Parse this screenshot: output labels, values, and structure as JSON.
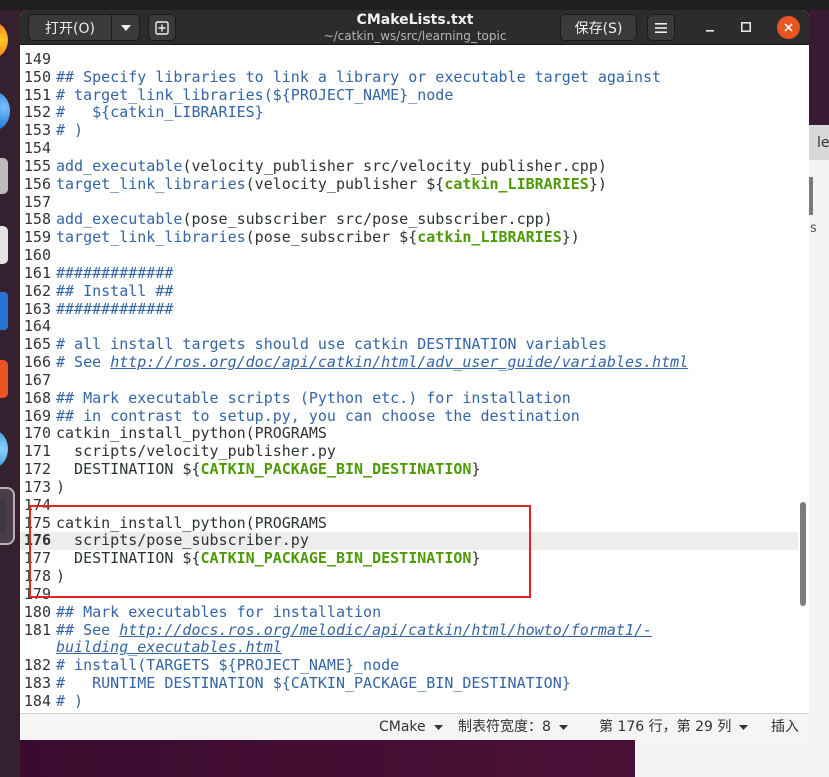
{
  "window": {
    "title": "CMakeLists.txt",
    "subtitle": "~/catkin_ws/src/learning_topic"
  },
  "header": {
    "open_label": "打开(O)",
    "open_menu_icon": "chevron-down-icon",
    "new_tab_icon": "tab-new-icon",
    "save_label": "保存(S)",
    "menu_icon": "hamburger-menu-icon",
    "window_controls": {
      "minimize_icon": "minimize-icon",
      "maximize_icon": "maximize-icon",
      "close_icon": "close-icon"
    }
  },
  "editor": {
    "lines": [
      {
        "n": "149",
        "seg": []
      },
      {
        "n": "150",
        "seg": [
          {
            "t": "## Specify libraries to link a library or executable target against",
            "c": "#3465a4"
          }
        ]
      },
      {
        "n": "151",
        "seg": [
          {
            "t": "# target_link_libraries(${PROJECT_NAME}_node",
            "c": "#3465a4"
          }
        ]
      },
      {
        "n": "152",
        "seg": [
          {
            "t": "#   ${catkin_LIBRARIES}",
            "c": "#3465a4"
          }
        ]
      },
      {
        "n": "153",
        "seg": [
          {
            "t": "# )",
            "c": "#3465a4"
          }
        ]
      },
      {
        "n": "154",
        "seg": []
      },
      {
        "n": "155",
        "seg": [
          {
            "t": "add_executable",
            "c": "#3465a4"
          },
          {
            "t": "(velocity_publisher src/velocity_publisher.cpp)",
            "c": "#2e3436"
          }
        ]
      },
      {
        "n": "156",
        "seg": [
          {
            "t": "target_link_libraries",
            "c": "#3465a4"
          },
          {
            "t": "(velocity_publisher ${",
            "c": "#2e3436"
          },
          {
            "t": "catkin_LIBRARIES",
            "c": "#4e9a06",
            "b": true
          },
          {
            "t": "})",
            "c": "#2e3436"
          }
        ]
      },
      {
        "n": "157",
        "seg": []
      },
      {
        "n": "158",
        "seg": [
          {
            "t": "add_executable",
            "c": "#3465a4"
          },
          {
            "t": "(pose_subscriber src/pose_subscriber.cpp)",
            "c": "#2e3436"
          }
        ]
      },
      {
        "n": "159",
        "seg": [
          {
            "t": "target_link_libraries",
            "c": "#3465a4"
          },
          {
            "t": "(pose_subscriber ${",
            "c": "#2e3436"
          },
          {
            "t": "catkin_LIBRARIES",
            "c": "#4e9a06",
            "b": true
          },
          {
            "t": "})",
            "c": "#2e3436"
          }
        ]
      },
      {
        "n": "160",
        "seg": []
      },
      {
        "n": "161",
        "seg": [
          {
            "t": "#############",
            "c": "#3465a4"
          }
        ]
      },
      {
        "n": "162",
        "seg": [
          {
            "t": "## Install ##",
            "c": "#3465a4"
          }
        ]
      },
      {
        "n": "163",
        "seg": [
          {
            "t": "#############",
            "c": "#3465a4"
          }
        ]
      },
      {
        "n": "164",
        "seg": []
      },
      {
        "n": "165",
        "seg": [
          {
            "t": "# all install targets should use catkin DESTINATION variables",
            "c": "#3465a4"
          }
        ]
      },
      {
        "n": "166",
        "seg": [
          {
            "t": "# See ",
            "c": "#3465a4"
          },
          {
            "t": "http://ros.org/doc/api/catkin/html/adv_user_guide/variables.html",
            "c": "#3465a4",
            "u": true
          }
        ]
      },
      {
        "n": "167",
        "seg": []
      },
      {
        "n": "168",
        "seg": [
          {
            "t": "## Mark executable scripts (Python etc.) for installation",
            "c": "#3465a4"
          }
        ]
      },
      {
        "n": "169",
        "seg": [
          {
            "t": "## in contrast to setup.py, you can choose the destination",
            "c": "#3465a4"
          }
        ]
      },
      {
        "n": "170",
        "seg": [
          {
            "t": "catkin_install_python(PROGRAMS",
            "c": "#2e3436"
          }
        ]
      },
      {
        "n": "171",
        "seg": [
          {
            "t": "  scripts/velocity_publisher.py",
            "c": "#2e3436"
          }
        ]
      },
      {
        "n": "172",
        "seg": [
          {
            "t": "  DESTINATION ${",
            "c": "#2e3436"
          },
          {
            "t": "CATKIN_PACKAGE_BIN_DESTINATION",
            "c": "#4e9a06",
            "b": true
          },
          {
            "t": "}",
            "c": "#2e3436"
          }
        ]
      },
      {
        "n": "173",
        "seg": [
          {
            "t": ")",
            "c": "#2e3436"
          }
        ]
      },
      {
        "n": "174",
        "seg": []
      },
      {
        "n": "175",
        "seg": [
          {
            "t": "catkin_install_python(PROGRAMS",
            "c": "#2e3436"
          }
        ]
      },
      {
        "n": "176",
        "cur": true,
        "seg": [
          {
            "t": "  scripts/pose_subscriber.py",
            "c": "#2e3436"
          }
        ]
      },
      {
        "n": "177",
        "seg": [
          {
            "t": "  DESTINATION ${",
            "c": "#2e3436"
          },
          {
            "t": "CATKIN_PACKAGE_BIN_DESTINATION",
            "c": "#4e9a06",
            "b": true
          },
          {
            "t": "}",
            "c": "#2e3436"
          }
        ]
      },
      {
        "n": "178",
        "seg": [
          {
            "t": ")",
            "c": "#2e3436"
          }
        ]
      },
      {
        "n": "179",
        "seg": []
      },
      {
        "n": "180",
        "seg": [
          {
            "t": "## Mark executables for installation",
            "c": "#3465a4"
          }
        ]
      },
      {
        "n": "181",
        "seg": [
          {
            "t": "## See ",
            "c": "#3465a4"
          },
          {
            "t": "http://docs.ros.org/melodic/api/catkin/html/howto/format1/-",
            "c": "#3465a4",
            "u": true
          }
        ]
      },
      {
        "seg": [
          {
            "t": "building_executables.html",
            "c": "#3465a4",
            "u": true
          }
        ]
      },
      {
        "n": "182",
        "seg": [
          {
            "t": "# install(TARGETS ${PROJECT_NAME}_node",
            "c": "#3465a4"
          }
        ]
      },
      {
        "n": "183",
        "seg": [
          {
            "t": "#   RUNTIME DESTINATION ${CATKIN_PACKAGE_BIN_DESTINATION}",
            "c": "#3465a4"
          }
        ]
      },
      {
        "n": "184",
        "seg": [
          {
            "t": "# )",
            "c": "#3465a4"
          }
        ]
      }
    ]
  },
  "status": {
    "language": "CMake",
    "tab_width": "制表符宽度：8",
    "position": "第 176 行，第 29 列",
    "mode": "插入",
    "dropdown_icon": "chevron-down-icon"
  },
  "background_window": {
    "tab_text": "le",
    "body_text": "s"
  },
  "colors": {
    "header_bg": "#2c2c2c",
    "close_button": "#e95420",
    "comment": "#3465a4",
    "variable": "#4e9a06",
    "annotation_box": "#e0261f",
    "current_line_bg": "#ededeb"
  }
}
